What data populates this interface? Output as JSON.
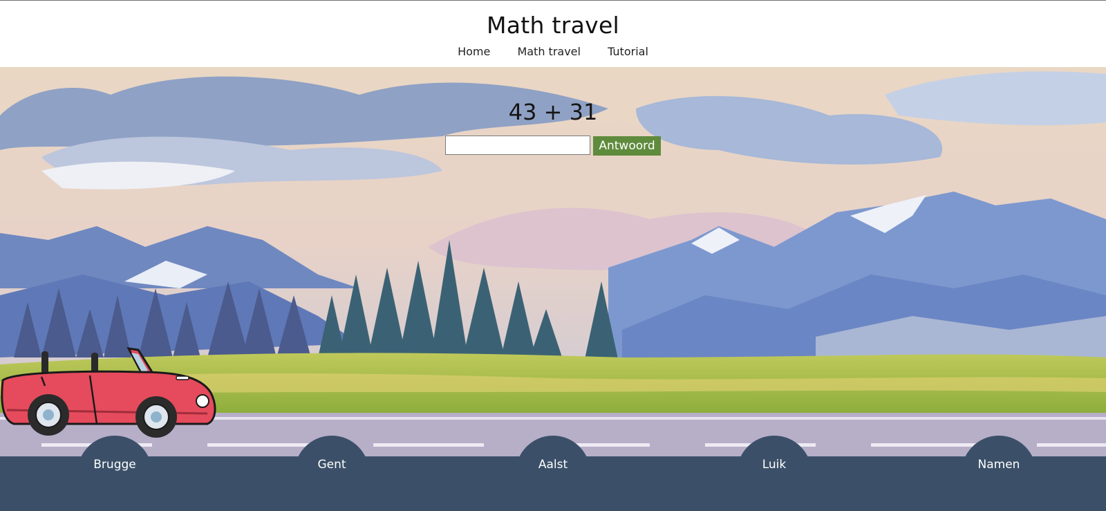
{
  "header": {
    "title": "Math travel",
    "nav": [
      "Home",
      "Math travel",
      "Tutorial"
    ]
  },
  "quiz": {
    "question": "43 + 31",
    "input_value": "",
    "button_label": "Antwoord"
  },
  "cities": [
    "Brugge",
    "Gent",
    "Aalst",
    "Luik",
    "Namen"
  ],
  "colors": {
    "button": "#5f8b3c",
    "footer": "#3b5068",
    "car": "#e54b5c"
  },
  "icons": {
    "car": "red-convertible-car-icon"
  }
}
